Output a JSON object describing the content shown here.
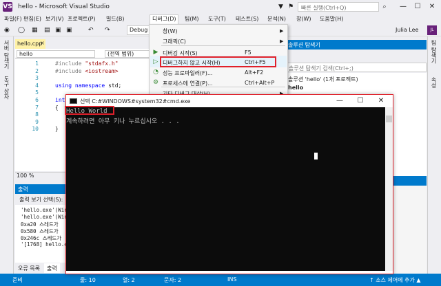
{
  "titlebar": {
    "logo_text": "VS",
    "title": "hello - Microsoft Visual Studio",
    "quick_launch_placeholder": "빠른 실행(Ctrl+Q)",
    "minimize": "—",
    "maximize": "☐",
    "close": "✕",
    "filter_icon": "▼",
    "notification_icon": "⚑"
  },
  "menubar": {
    "items": [
      "파일(F)",
      "편집(E)",
      "보기(V)",
      "프로젝트(P)",
      "빌드(B)",
      "디버그(D)",
      "팀(M)",
      "도구(T)",
      "테스트(S)",
      "분석(N)",
      "창(W)",
      "도움말(H)"
    ]
  },
  "toolbar": {
    "config": "Debug",
    "user": "Julia Lee",
    "avatar": "JL"
  },
  "left_rail": {
    "tabs": [
      "서버 탐색기",
      "도구 상자"
    ]
  },
  "right_rail": {
    "tabs": [
      "팀 탐색기",
      "속성"
    ]
  },
  "editor": {
    "tab": "hello.cpp",
    "tab_close": "×",
    "scope_left": "hello",
    "scope_right": "(전역 범위)",
    "lines": [
      {
        "no": "1",
        "tokens": [
          {
            "t": "#include ",
            "c": "pp"
          },
          {
            "t": "\"stdafx.h\"",
            "c": "str"
          }
        ]
      },
      {
        "no": "2",
        "tokens": [
          {
            "t": "#include ",
            "c": "pp"
          },
          {
            "t": "<iostream>",
            "c": "str"
          }
        ]
      },
      {
        "no": "3",
        "tokens": []
      },
      {
        "no": "4",
        "tokens": [
          {
            "t": "using namespace ",
            "c": "kw"
          },
          {
            "t": "std;",
            "c": ""
          }
        ]
      },
      {
        "no": "5",
        "tokens": []
      },
      {
        "no": "6",
        "tokens": [
          {
            "t": "int",
            "c": "kw"
          }
        ]
      },
      {
        "no": "7",
        "tokens": [
          {
            "t": "{",
            "c": ""
          }
        ]
      },
      {
        "no": "8",
        "tokens": []
      },
      {
        "no": "9",
        "tokens": []
      },
      {
        "no": "10",
        "tokens": [
          {
            "t": "}",
            "c": ""
          }
        ]
      }
    ],
    "zoom": "100 %"
  },
  "output": {
    "header": "출력",
    "source_label": "출력 보기 선택(S):",
    "lines": [
      "'hello.exe'(Win",
      "'hello.exe'(Win",
      "0xa20 스레드가 ",
      "0x580 스레드가 ",
      "0x246c 스레드가 ",
      "'[1768] hello.e"
    ],
    "tabs": [
      "오류 목록",
      "출력"
    ]
  },
  "solution_explorer": {
    "header": "솔루션 탐색기",
    "search_placeholder": "솔루션 탐색기 검색(Ctrl+;)",
    "solution": "솔루션 'hello' (1개 프로젝트)",
    "project": "hello"
  },
  "debug_menu": {
    "items": [
      {
        "label": "창(W)",
        "shortcut": "",
        "submenu": true,
        "icon": ""
      },
      {
        "label": "그래픽(C)",
        "shortcut": "",
        "submenu": true,
        "icon": ""
      },
      {
        "label": "디버깅 시작(S)",
        "shortcut": "F5",
        "submenu": false,
        "icon": "▶"
      },
      {
        "label": "디버그하지 않고 시작(H)",
        "shortcut": "Ctrl+F5",
        "submenu": false,
        "icon": "▷"
      },
      {
        "label": "성능 프로파일러(F)...",
        "shortcut": "Alt+F2",
        "submenu": false,
        "icon": "◔"
      },
      {
        "label": "프로세스에 연결(P)...",
        "shortcut": "Ctrl+Alt+P",
        "submenu": false,
        "icon": "⚙"
      },
      {
        "label": "기타 디버그 대상(H)",
        "shortcut": "",
        "submenu": true,
        "icon": ""
      }
    ]
  },
  "cmd": {
    "title": "선택 C:#WINDOWS#system32#cmd.exe",
    "lines": [
      "Hello World",
      "계속하려면 아무 키나 누르십시오 . . ."
    ],
    "minimize": "—",
    "maximize": "☐",
    "close": "✕"
  },
  "statusbar": {
    "ready": "준비",
    "line": "줄: 10",
    "col": "열: 2",
    "char": "문자: 2",
    "ins": "INS",
    "source_control": "↑ 소스 제어에 추가 ▲"
  },
  "colors": {
    "accent": "#007acc",
    "brand": "#68217a",
    "annotation": "#e0202a",
    "console_bg": "#0c0c0c"
  }
}
